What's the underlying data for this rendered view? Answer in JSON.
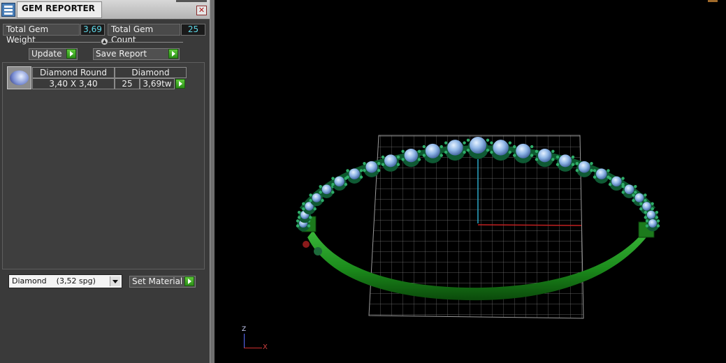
{
  "window": {
    "title": "GEM REPORTER",
    "close_symbol": "✕"
  },
  "totals": {
    "weight_label": "Total Gem Weight",
    "weight_value": "3,69",
    "count_label": "Total Gem Count",
    "count_value": "25"
  },
  "toolbar": {
    "update_label": "Update",
    "save_report_label": "Save Report",
    "separator_symbol": "▲"
  },
  "gem_table": {
    "rows": [
      {
        "shape": "Diamond Round",
        "material": "Diamond",
        "size": "3,40 X 3,40",
        "count": "25",
        "weight": "3,69tw"
      }
    ]
  },
  "material": {
    "selected": "Diamond    (3,52 spg)",
    "set_label": "Set Material"
  },
  "viewport": {
    "axis_z": "Z",
    "axis_x": "X"
  },
  "colors": {
    "panel_bg": "#3a3a3a",
    "value_text": "#5fd8e8",
    "go_button": "#3aa81e",
    "band_green": "#1f8a1f",
    "gem_blue": "#9fc0ea"
  },
  "icons": [
    "gem-reporter-app-icon",
    "close-icon",
    "play-arrow-icon",
    "dropdown-arrow-icon",
    "gem-thumbnail"
  ]
}
